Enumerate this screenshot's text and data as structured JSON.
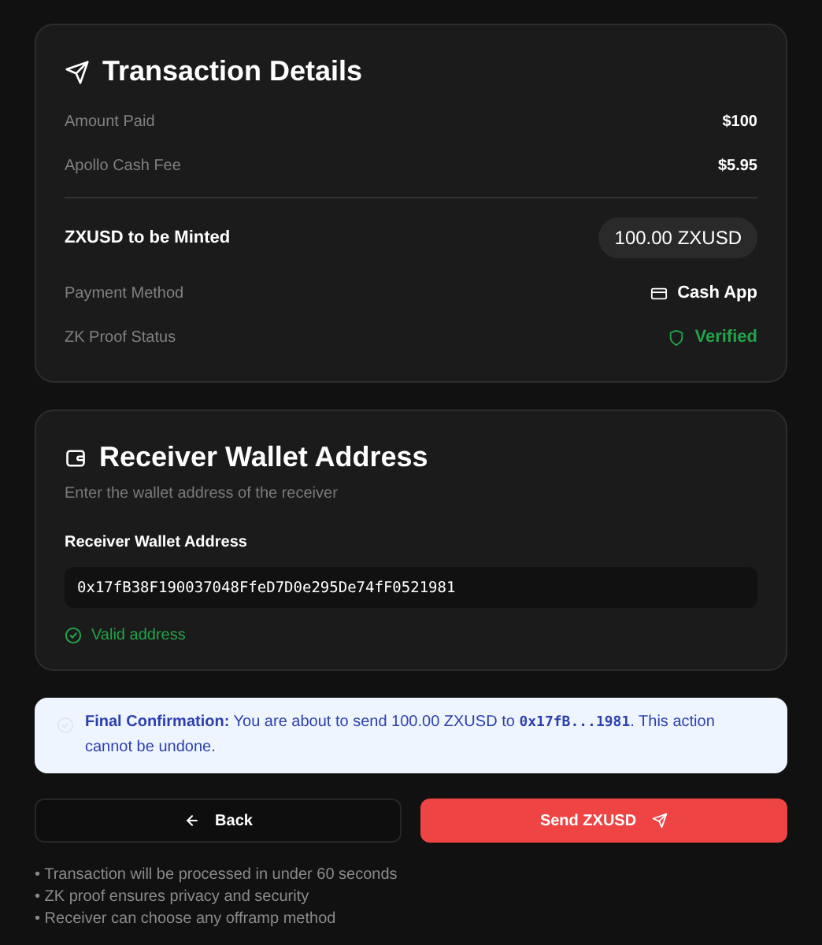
{
  "transaction": {
    "title": "Transaction Details",
    "rows": [
      {
        "kind": "plain",
        "label": "Amount Paid",
        "value": "$100"
      },
      {
        "kind": "plain",
        "label": "Apollo Cash Fee",
        "value": "$5.95"
      },
      {
        "kind": "total",
        "label": "ZXUSD to be Minted",
        "value": "100.00 ZXUSD"
      },
      {
        "kind": "method",
        "label": "Payment Method",
        "value": "Cash App"
      },
      {
        "kind": "status",
        "label": "ZK Proof Status",
        "value": "Verified"
      }
    ]
  },
  "receiver": {
    "title": "Receiver Wallet Address",
    "subtitle": "Enter the wallet address of the receiver",
    "field_label": "Receiver Wallet Address",
    "value": "0x17fB38F190037048FfeD7D0e295De74fF0521981",
    "validation": "Valid address",
    "valid": true
  },
  "confirmation": {
    "label": "Final Confirmation:",
    "before": "You are about to send 100.00 ZXUSD to ",
    "address": "0x17fB...1981",
    "after": ". This action cannot be undone."
  },
  "buttons": [
    {
      "kind": "back",
      "label": "Back"
    },
    {
      "kind": "send",
      "label": "Send ZXUSD"
    }
  ],
  "notes": [
    "• Transaction will be processed in under 60 seconds",
    "• ZK proof ensures privacy and security",
    "• Receiver can choose any offramp method"
  ]
}
